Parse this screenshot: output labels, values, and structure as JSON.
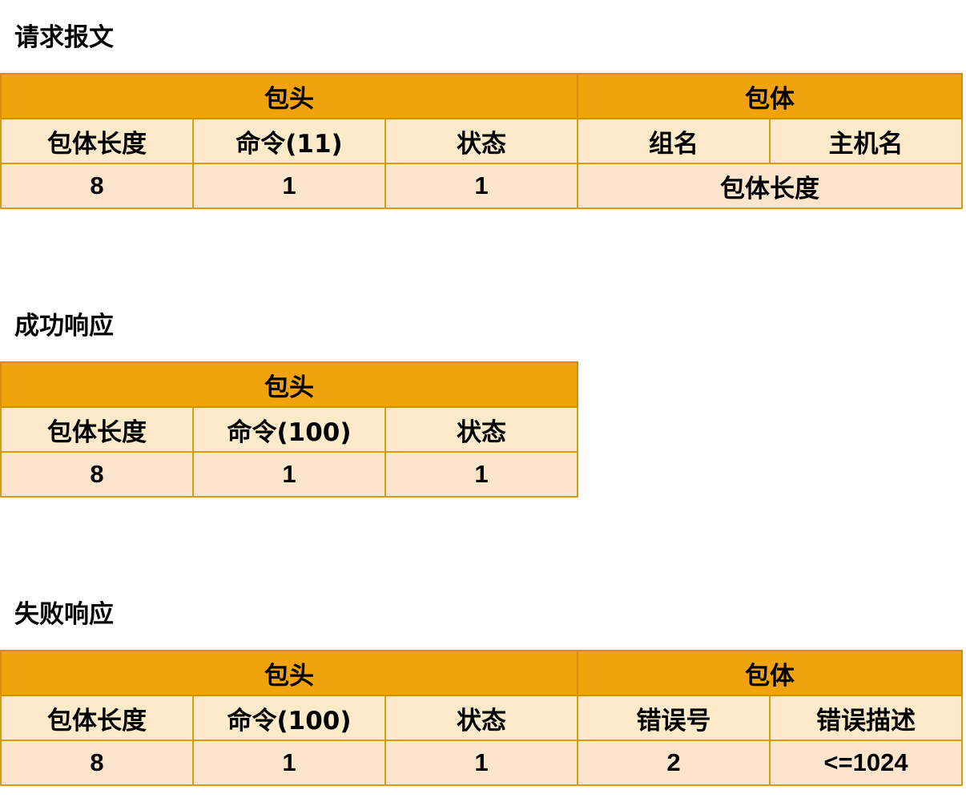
{
  "sections": [
    {
      "title": "请求报文",
      "group_headers": [
        "包头",
        "包体"
      ],
      "field_headers": [
        "包体长度",
        "命令(11)",
        "状态",
        "组名",
        "主机名"
      ],
      "values": [
        "8",
        "1",
        "1",
        "包体长度"
      ]
    },
    {
      "title": "成功响应",
      "group_headers": [
        "包头"
      ],
      "field_headers": [
        "包体长度",
        "命令(100)",
        "状态"
      ],
      "values": [
        "8",
        "1",
        "1"
      ]
    },
    {
      "title": "失败响应",
      "group_headers": [
        "包头",
        "包体"
      ],
      "field_headers": [
        "包体长度",
        "命令(100)",
        "状态",
        "错误号",
        "错误描述"
      ],
      "values": [
        "8",
        "1",
        "1",
        "2",
        "<=1024"
      ]
    }
  ],
  "colors": {
    "group_header_bg": "#f0a30c",
    "field_header_bg": "#fdeacb",
    "value_row_bg": "#fde4cd",
    "border": "#d99a0e"
  }
}
